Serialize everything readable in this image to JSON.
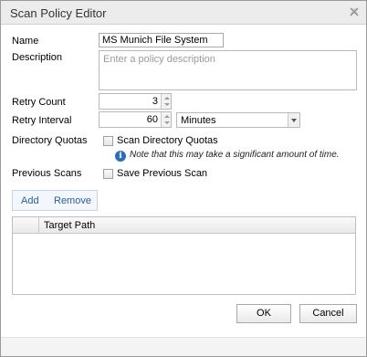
{
  "dialog": {
    "title": "Scan Policy Editor",
    "close_icon": "close-icon"
  },
  "form": {
    "name_label": "Name",
    "name_value": "MS Munich File System",
    "description_label": "Description",
    "description_placeholder": "Enter a policy description",
    "retry_count_label": "Retry Count",
    "retry_count_value": "3",
    "retry_interval_label": "Retry Interval",
    "retry_interval_value": "60",
    "retry_interval_unit": "Minutes",
    "directory_quotas_label": "Directory Quotas",
    "scan_directory_quotas_label": "Scan Directory Quotas",
    "scan_directory_quotas_checked": false,
    "quota_note": "Note that this may take a significant amount of time.",
    "previous_scans_label": "Previous Scans",
    "save_previous_scan_label": "Save Previous Scan",
    "save_previous_scan_checked": false
  },
  "target_toolbar": {
    "add_label": "Add",
    "remove_label": "Remove"
  },
  "target_grid": {
    "columns": [
      "",
      "Target Path"
    ],
    "rows": []
  },
  "buttons": {
    "ok_label": "OK",
    "cancel_label": "Cancel"
  },
  "colors": {
    "link": "#2a5f9e",
    "info": "#2a6ebb"
  }
}
